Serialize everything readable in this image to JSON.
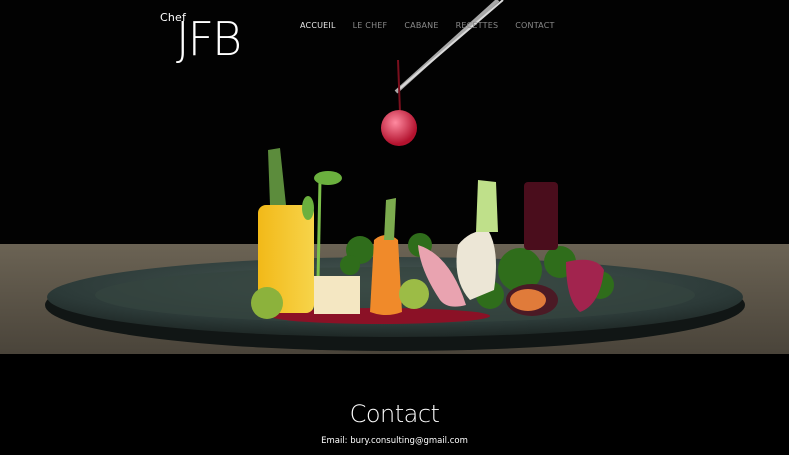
{
  "logo": {
    "prefix": "Chef",
    "name": "JFB"
  },
  "nav": {
    "items": [
      {
        "label": "ACCUEIL",
        "active": true
      },
      {
        "label": "LE CHEF",
        "active": false
      },
      {
        "label": "CABANE",
        "active": false
      },
      {
        "label": "RECETTES",
        "active": false
      },
      {
        "label": "CONTACT",
        "active": false
      }
    ]
  },
  "contact": {
    "title": "Contact",
    "email_line": "Email: bury.consulting@gmail.com"
  },
  "colors": {
    "background": "#000000",
    "text": "#ffffff",
    "nav_inactive": "#8a8a8a",
    "table": "#5c554a",
    "plate": "#2c3a38"
  }
}
